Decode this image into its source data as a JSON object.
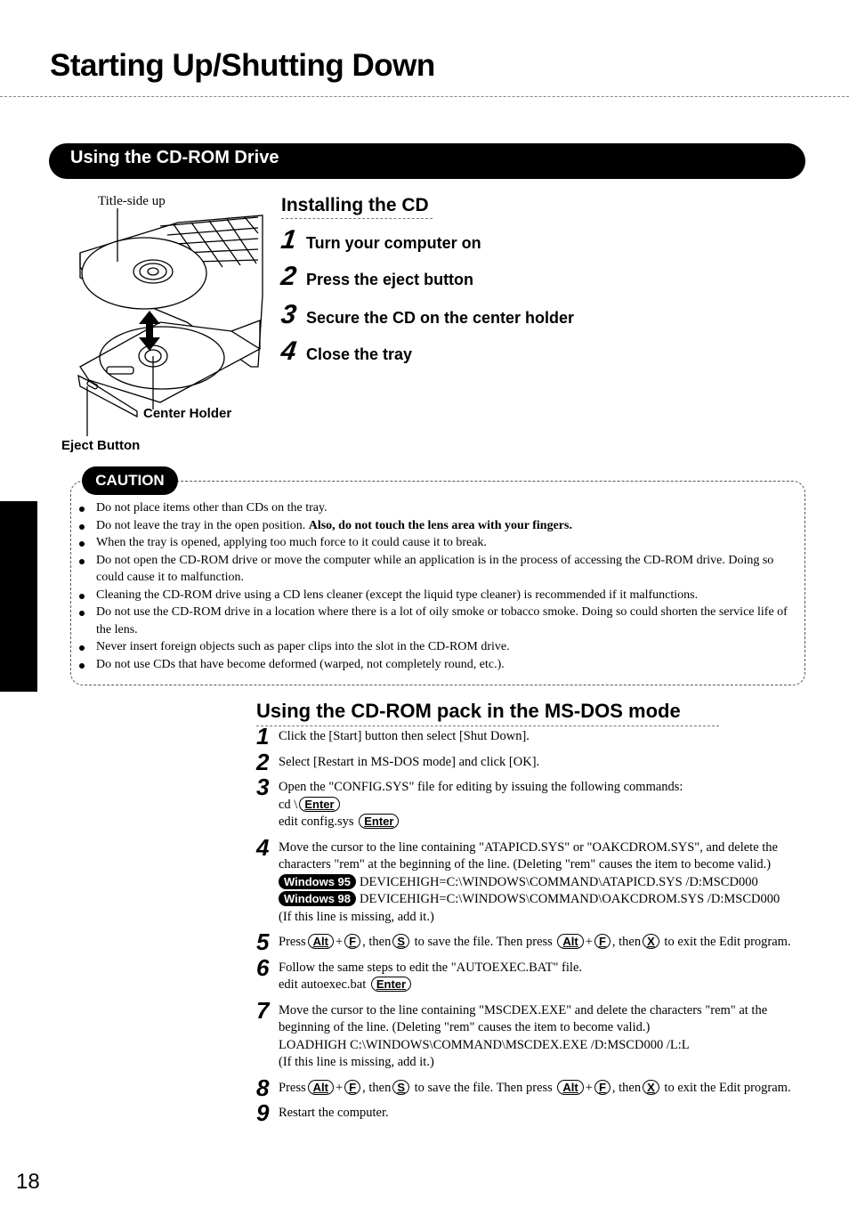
{
  "page": {
    "title": "Starting Up/Shutting Down",
    "page_number": "18"
  },
  "section": {
    "title": "Using the CD-ROM Drive"
  },
  "illustration": {
    "label_title_side": "Title-side up",
    "label_center_holder": "Center Holder",
    "label_eject_button": "Eject Button"
  },
  "installing": {
    "heading": "Installing the CD",
    "steps": [
      {
        "num": "1",
        "text": "Turn your computer on"
      },
      {
        "num": "2",
        "text": "Press the eject button"
      },
      {
        "num": "3",
        "text": "Secure the CD on the center holder"
      },
      {
        "num": "4",
        "text": "Close the tray"
      }
    ]
  },
  "caution": {
    "label": "CAUTION",
    "items": [
      {
        "text": "Do not place items other than CDs on the tray.",
        "bold": ""
      },
      {
        "text": "Do not leave the tray in the open position.  ",
        "bold": "Also, do not touch the lens area with your fingers."
      },
      {
        "text": "When the tray is opened, applying too much force to it could cause it to break.",
        "bold": ""
      },
      {
        "text": "Do not open the CD-ROM drive or move the computer while an application is in the process of accessing the CD-ROM drive. Doing so could cause it to malfunction.",
        "bold": ""
      },
      {
        "text": "Cleaning the CD-ROM drive using a CD lens cleaner (except the liquid type cleaner) is recommended if it malfunctions.",
        "bold": ""
      },
      {
        "text": "Do not use the CD-ROM drive in a location where there is a lot of oily smoke or tobacco smoke.  Doing so could shorten the service life of the lens.",
        "bold": ""
      },
      {
        "text": "Never insert foreign objects such as paper clips into the slot in the CD-ROM drive.",
        "bold": ""
      },
      {
        "text": "Do not use CDs that have become deformed (warped, not completely round, etc.).",
        "bold": ""
      }
    ]
  },
  "msdos": {
    "heading": "Using the CD-ROM pack in the MS-DOS mode",
    "keys": {
      "enter": "Enter",
      "alt": "Alt",
      "f": "F",
      "s": "S",
      "x": "X"
    },
    "step1": {
      "num": "1",
      "text": "Click the [Start] button then select [Shut Down]."
    },
    "step2": {
      "num": "2",
      "text": "Select [Restart in MS-DOS mode] and click [OK]."
    },
    "step3": {
      "num": "3",
      "text": "Open the \"CONFIG.SYS\" file for editing by issuing the following commands:",
      "cmd1": "cd \\",
      "cmd2": "edit config.sys"
    },
    "step4": {
      "num": "4",
      "text": "Move the cursor to the line containing \"ATAPICD.SYS\" or \"OAKCDROM.SYS\", and delete the characters \"rem\" at the beginning of the line. (Deleting \"rem\" causes the item to become valid.)",
      "win95_label": "Windows  95",
      "win95_line": "DEVICEHIGH=C:\\WINDOWS\\COMMAND\\ATAPICD.SYS /D:MSCD000",
      "win98_label": "Windows  98",
      "win98_line": "DEVICEHIGH=C:\\WINDOWS\\COMMAND\\OAKCDROM.SYS /D:MSCD000",
      "note": "(If this line is missing, add it.)"
    },
    "step5": {
      "num": "5",
      "press": "Press",
      "plus": "+",
      "then": ", then",
      "save": "to save the file.  Then press",
      "then2": ", then",
      "exit": "to exit the Edit program."
    },
    "step6": {
      "num": "6",
      "text": "Follow the same steps to edit the \"AUTOEXEC.BAT\" file.",
      "cmd": "edit autoexec.bat"
    },
    "step7": {
      "num": "7",
      "text": "Move the cursor to the line containing \"MSCDEX.EXE\" and delete the characters \"rem\" at the beginning of the line. (Deleting \"rem\" causes the item to become valid.)",
      "line": "LOADHIGH  C:\\WINDOWS\\COMMAND\\MSCDEX.EXE /D:MSCD000 /L:L",
      "note": "(If this line is missing, add it.)"
    },
    "step8": {
      "num": "8",
      "press": "Press",
      "plus": "+",
      "then": ", then",
      "save": "to save the file.  Then press",
      "then2": ", then",
      "exit": "to exit the Edit program."
    },
    "step9": {
      "num": "9",
      "text": "Restart the computer."
    }
  }
}
